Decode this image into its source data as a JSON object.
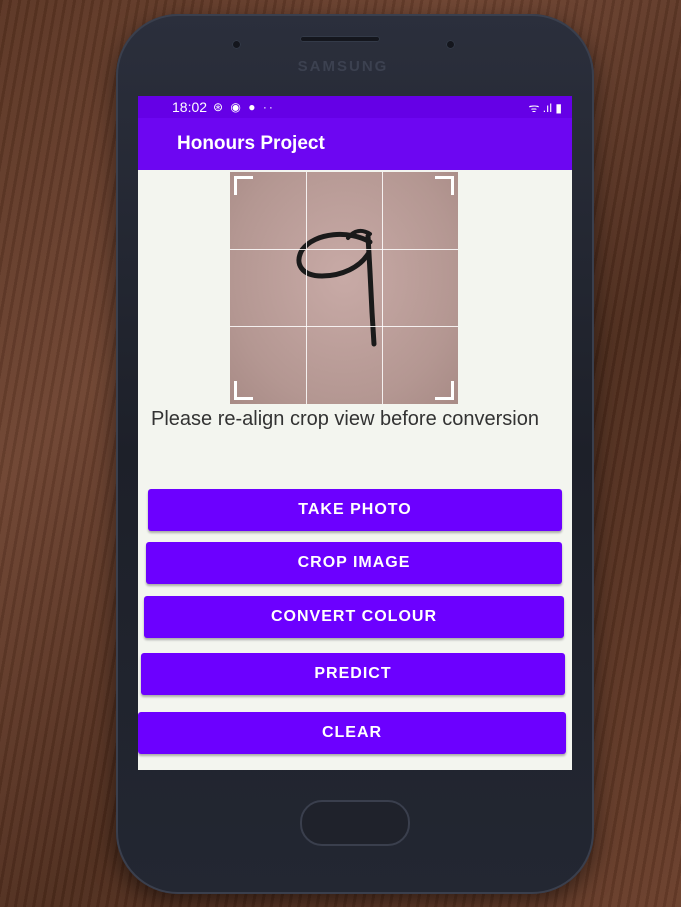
{
  "status_bar": {
    "time": "18:02",
    "left_icons": "⊛ ◉ ● ··",
    "right_icons": "ᯤ .ıl ▮"
  },
  "device": {
    "brand": "SAMSUNG"
  },
  "app_bar": {
    "title": "Honours Project"
  },
  "crop_view": {
    "handwritten_digit": "9"
  },
  "message": "Please re-align crop view before conversion",
  "buttons": {
    "take_photo": "TAKE PHOTO",
    "crop_image": "CROP IMAGE",
    "convert_colour": "CONVERT COLOUR",
    "predict": "PREDICT",
    "clear": "CLEAR"
  },
  "colors": {
    "accent": "#6c00ff",
    "app_bar": "#6d06f2",
    "status_bar": "#6500e6"
  }
}
